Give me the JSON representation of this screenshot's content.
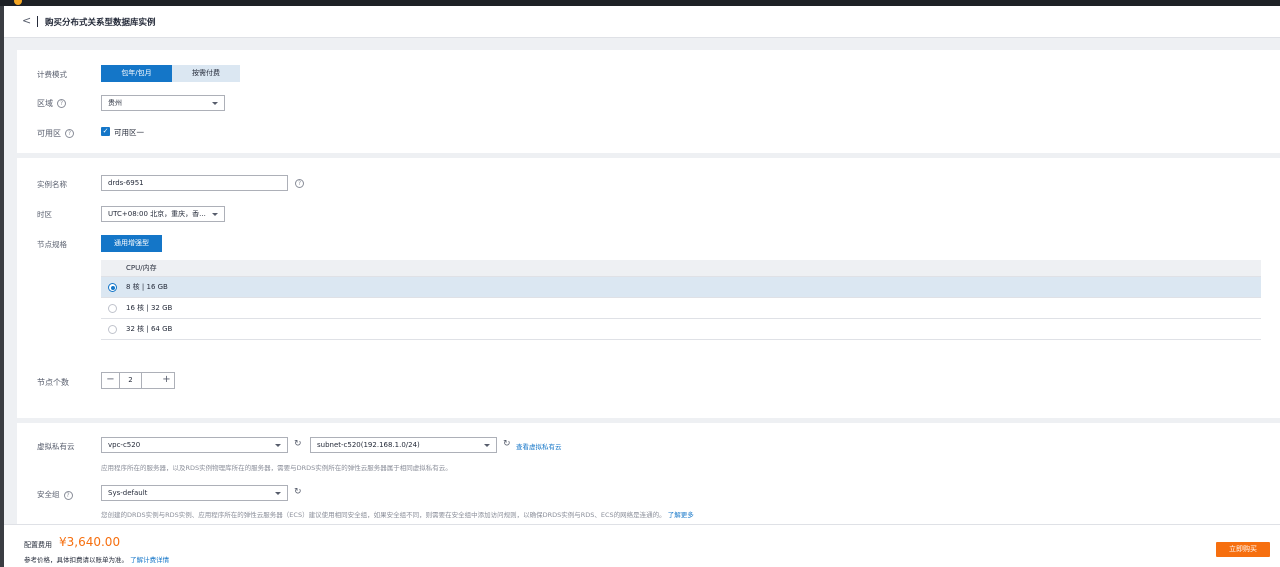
{
  "header": {
    "back": "<",
    "title": "购买分布式关系型数据库实例"
  },
  "billing": {
    "label": "计费模式",
    "options": [
      "包年/包月",
      "按需付费"
    ]
  },
  "region": {
    "label": "区域",
    "value": "贵州"
  },
  "az": {
    "label": "可用区",
    "value": "可用区一"
  },
  "instance": {
    "label": "实例名称",
    "value": "drds-6951"
  },
  "timezone": {
    "label": "时区",
    "value": "UTC+08:00 北京，重庆，香..."
  },
  "node_spec": {
    "label": "节点规格",
    "type_button": "通用增强型",
    "column": "CPU/内存",
    "rows": [
      "8 核 | 16 GB",
      "16 核 | 32 GB",
      "32 核 | 64 GB"
    ],
    "selected_index": 0
  },
  "node_count": {
    "label": "节点个数",
    "minus": "−",
    "value": "2",
    "plus": "+"
  },
  "vpc": {
    "label": "虚拟私有云",
    "vpc_value": "vpc-c520",
    "subnet_value": "subnet-c520(192.168.1.0/24)",
    "view_link": "查看虚拟私有云",
    "hint": "应用程序所在的服务器，以及RDS实例物理库所在的服务器，需要与DRDS实例所在的弹性云服务器属于相同虚拟私有云。"
  },
  "security_group": {
    "label": "安全组",
    "value": "Sys-default",
    "hint": "您创建的DRDS实例与RDS实例、应用程序所在的弹性云服务器（ECS）建议使用相同安全组，如果安全组不同，则需要在安全组中添加访问规则，以确保DRDS实例与RDS、ECS的网络是连通的。",
    "more_link": "了解更多"
  },
  "footer": {
    "fee_label": "配置费用",
    "price": "¥3,640.00",
    "note": "参考价格，具体扣费请以账单为准。",
    "detail_link": "了解计费详情",
    "buy_button": "立即购买"
  },
  "colors": {
    "primary": "#1476c8",
    "price": "#f66f0f",
    "buy": "#f66f0f"
  }
}
